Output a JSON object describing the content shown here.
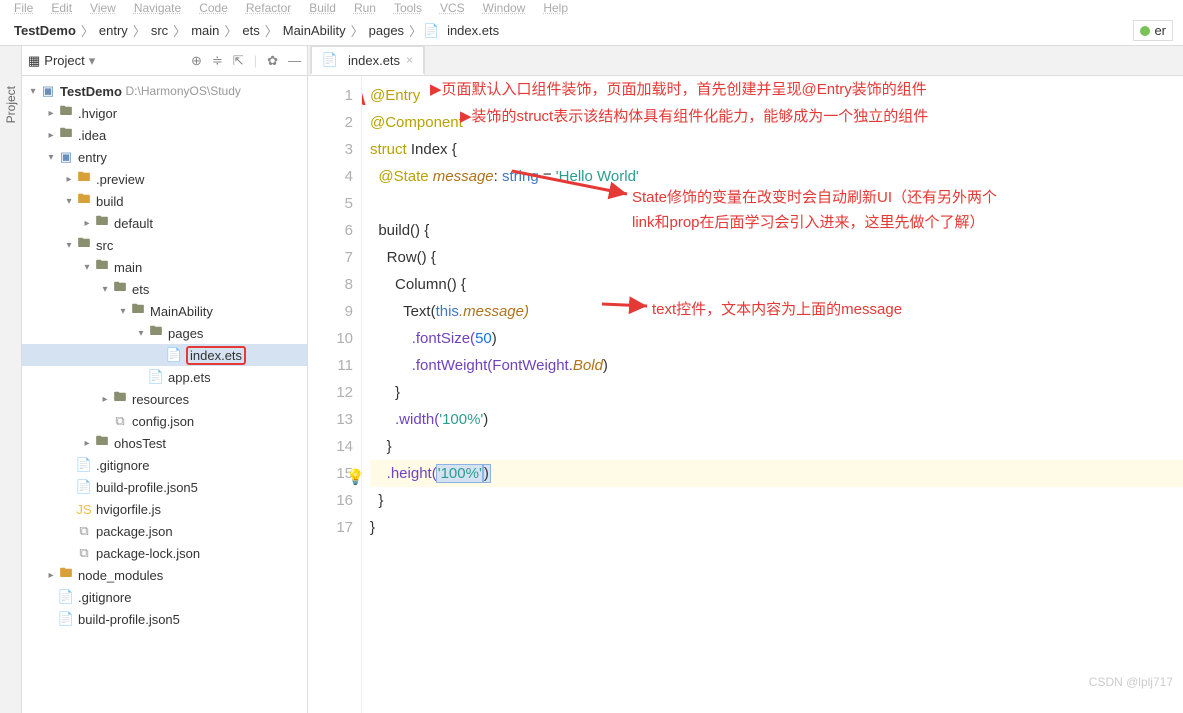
{
  "menu": [
    "File",
    "Edit",
    "View",
    "Navigate",
    "Code",
    "Refactor",
    "Build",
    "Run",
    "Tools",
    "VCS",
    "Window",
    "Help",
    "TestDemo",
    "index.ets"
  ],
  "breadcrumbs": [
    "TestDemo",
    "entry",
    "src",
    "main",
    "ets",
    "MainAbility",
    "pages",
    "index.ets"
  ],
  "right_btn": "er",
  "left_tab": "Project",
  "project_toolbar": {
    "label": "Project"
  },
  "proj_root": {
    "name": "TestDemo",
    "path": "D:\\HarmonyOS\\Study"
  },
  "tree": {
    "hvigor": ".hvigor",
    "idea": ".idea",
    "entry": "entry",
    "preview": ".preview",
    "build": "build",
    "default": "default",
    "src": "src",
    "main": "main",
    "ets": "ets",
    "MainAbility": "MainAbility",
    "pages": "pages",
    "index_ets": "index.ets",
    "app_ets": "app.ets",
    "resources": "resources",
    "config_json": "config.json",
    "ohosTest": "ohosTest",
    "gitignore": ".gitignore",
    "build_profile": "build-profile.json5",
    "hvigorfile": "hvigorfile.js",
    "package_json": "package.json",
    "package_lock": "package-lock.json",
    "node_modules": "node_modules",
    "gitignore2": ".gitignore",
    "build_profile2": "build-profile.json5"
  },
  "tab": {
    "label": "index.ets"
  },
  "code": {
    "l1_kw": "@Entry",
    "l2_kw": "@Component",
    "l3_kw": "struct",
    "l3_name": "Index",
    "l3_brace": " {",
    "l4_kw": "@State",
    "l4_var": "message",
    "l4_type": "string",
    "l4_eq": " = ",
    "l4_str": "'Hello World'",
    "l6": "build() {",
    "l7": "Row() {",
    "l8": "Column() {",
    "l9a": "Text(",
    "l9b": "this",
    "l9c": ".message)",
    "l10a": ".fontSize(",
    "l10b": "50",
    "l10c": ")",
    "l11a": ".fontWeight(FontWeight.",
    "l11b": "Bold",
    "l11c": ")",
    "l12": "}",
    "l13a": ".width(",
    "l13b": "'100%'",
    "l13c": ")",
    "l14": "}",
    "l15a": ".height(",
    "l15b": "'100%'",
    "l15c": ")",
    "l16": "}",
    "l17": "}"
  },
  "ann": {
    "a1": "页面默认入口组件装饰，页面加载时，首先创建并呈现@Entry装饰的组件",
    "a2": "装饰的struct表示该结构体具有组件化能力，能够成为一个独立的组件",
    "a3": "State修饰的变量在改变时会自动刷新UI（还有另外两个",
    "a3b": "link和prop在后面学习会引入进来，这里先做个了解）",
    "a4": "text控件，文本内容为上面的message"
  },
  "watermark": "CSDN @lplj717"
}
